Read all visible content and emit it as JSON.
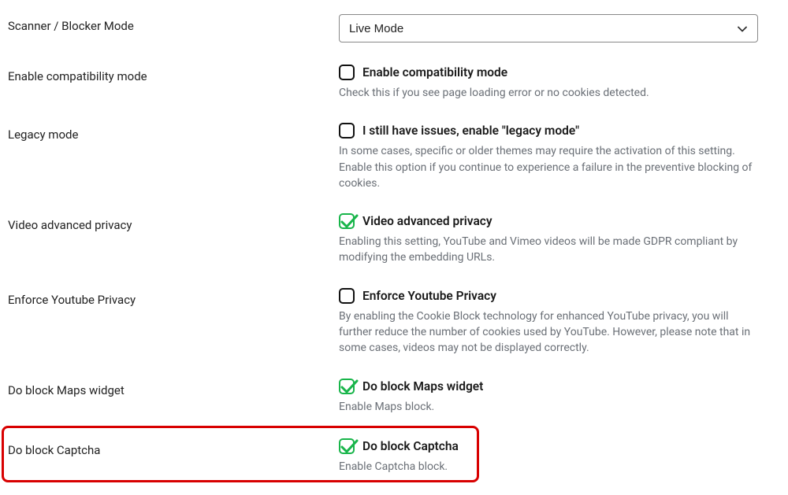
{
  "scanner": {
    "label": "Scanner / Blocker Mode",
    "selected": "Live Mode"
  },
  "compat": {
    "label": "Enable compatibility mode",
    "check_label": "Enable compatibility mode",
    "desc": "Check this if you see page loading error or no cookies detected.",
    "checked": false
  },
  "legacy": {
    "label": "Legacy mode",
    "check_label": "I still have issues, enable \"legacy mode\"",
    "desc": "In some cases, specific or older themes may require the activation of this setting. Enable this option if you continue to experience a failure in the preventive blocking of cookies.",
    "checked": false
  },
  "video_privacy": {
    "label": "Video advanced privacy",
    "check_label": "Video advanced privacy",
    "desc": "Enabling this setting, YouTube and Vimeo videos will be made GDPR compliant by modifying the embedding URLs.",
    "checked": true
  },
  "yt_privacy": {
    "label": "Enforce Youtube Privacy",
    "check_label": "Enforce Youtube Privacy",
    "desc": "By enabling the Cookie Block technology for enhanced YouTube privacy, you will further reduce the number of cookies used by YouTube. However, please note that in some cases, videos may not be displayed correctly.",
    "checked": false
  },
  "maps": {
    "label": "Do block Maps widget",
    "check_label": "Do block Maps widget",
    "desc": "Enable Maps block.",
    "checked": true
  },
  "captcha": {
    "label": "Do block Captcha",
    "check_label": "Do block Captcha",
    "desc": "Enable Captcha block.",
    "checked": true
  }
}
